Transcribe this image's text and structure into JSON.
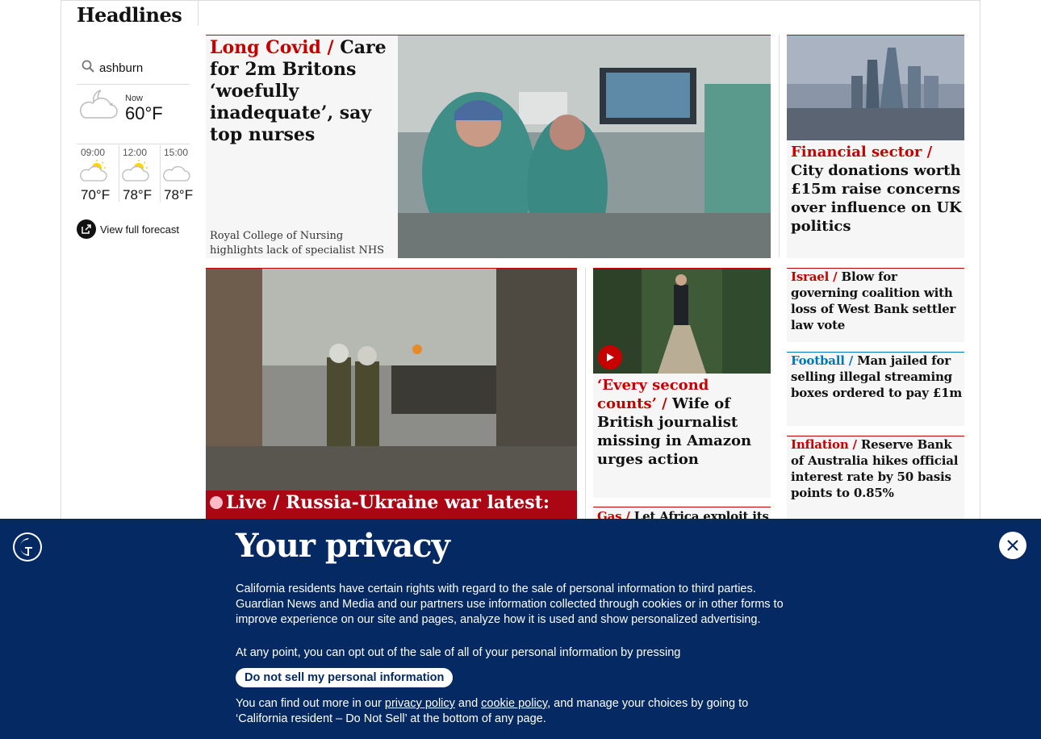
{
  "section": {
    "title": "Headlines"
  },
  "weather": {
    "location": "ashburn",
    "now_label": "Now",
    "now_temp": "60°F",
    "forecast": [
      {
        "time": "09:00",
        "temp": "70°F",
        "icon": "sun-cloud-icon"
      },
      {
        "time": "12:00",
        "temp": "78°F",
        "icon": "sun-cloud-icon"
      },
      {
        "time": "15:00",
        "temp": "78°F",
        "icon": "cloud-icon"
      }
    ],
    "view_forecast": "View full forecast"
  },
  "stories": {
    "lead": {
      "kicker": "Long Covid /",
      "headline": "Care for 2m Britons ‘woefully inadequate’, say top nurses",
      "standfirst": "Royal College of Nursing highlights lack of specialist NHS clinics and disparities in care around the UK"
    },
    "city": {
      "kicker": "Financial sector /",
      "headline": "City donations worth £15m raise concerns over influence on UK politics"
    },
    "israel": {
      "kicker": "Israel /",
      "headline": "Blow for governing coalition with loss of West Bank settler law vote"
    },
    "football": {
      "kicker": "Football /",
      "headline": "Man jailed for selling illegal streaming boxes ordered to pay £1m"
    },
    "inflation": {
      "kicker": "Inflation /",
      "headline": "Reserve Bank of Australia hikes official interest rate by 50 basis points to 0.85%"
    },
    "ukraine": {
      "kicker": "Live /",
      "headline": "Russia-Ukraine war latest:"
    },
    "amazon": {
      "kicker": "‘Every second counts’ /",
      "headline": "Wife of British journalist missing in Amazon urges action"
    },
    "gas": {
      "kicker": "Gas /",
      "headline": "Let Africa exploit its"
    }
  },
  "privacy": {
    "title": "Your privacy",
    "p1": "California residents have certain rights with regard to the sale of personal information to third parties. Guardian News and Media and our partners use information collected through cookies or in other forms to improve experience on our site and pages, analyze how it is used and show personalized advertising.",
    "p2": "At any point, you can opt out of the sale of all of your personal information by pressing",
    "button": "Do not sell my personal information",
    "p3_start": "You can find out more in our ",
    "privacy_link": "privacy policy",
    "and": " and ",
    "cookie_link": "cookie policy",
    "p3_end": ", and manage your choices by going to ‘California resident – Do Not Sell’ at the bottom of any page."
  }
}
